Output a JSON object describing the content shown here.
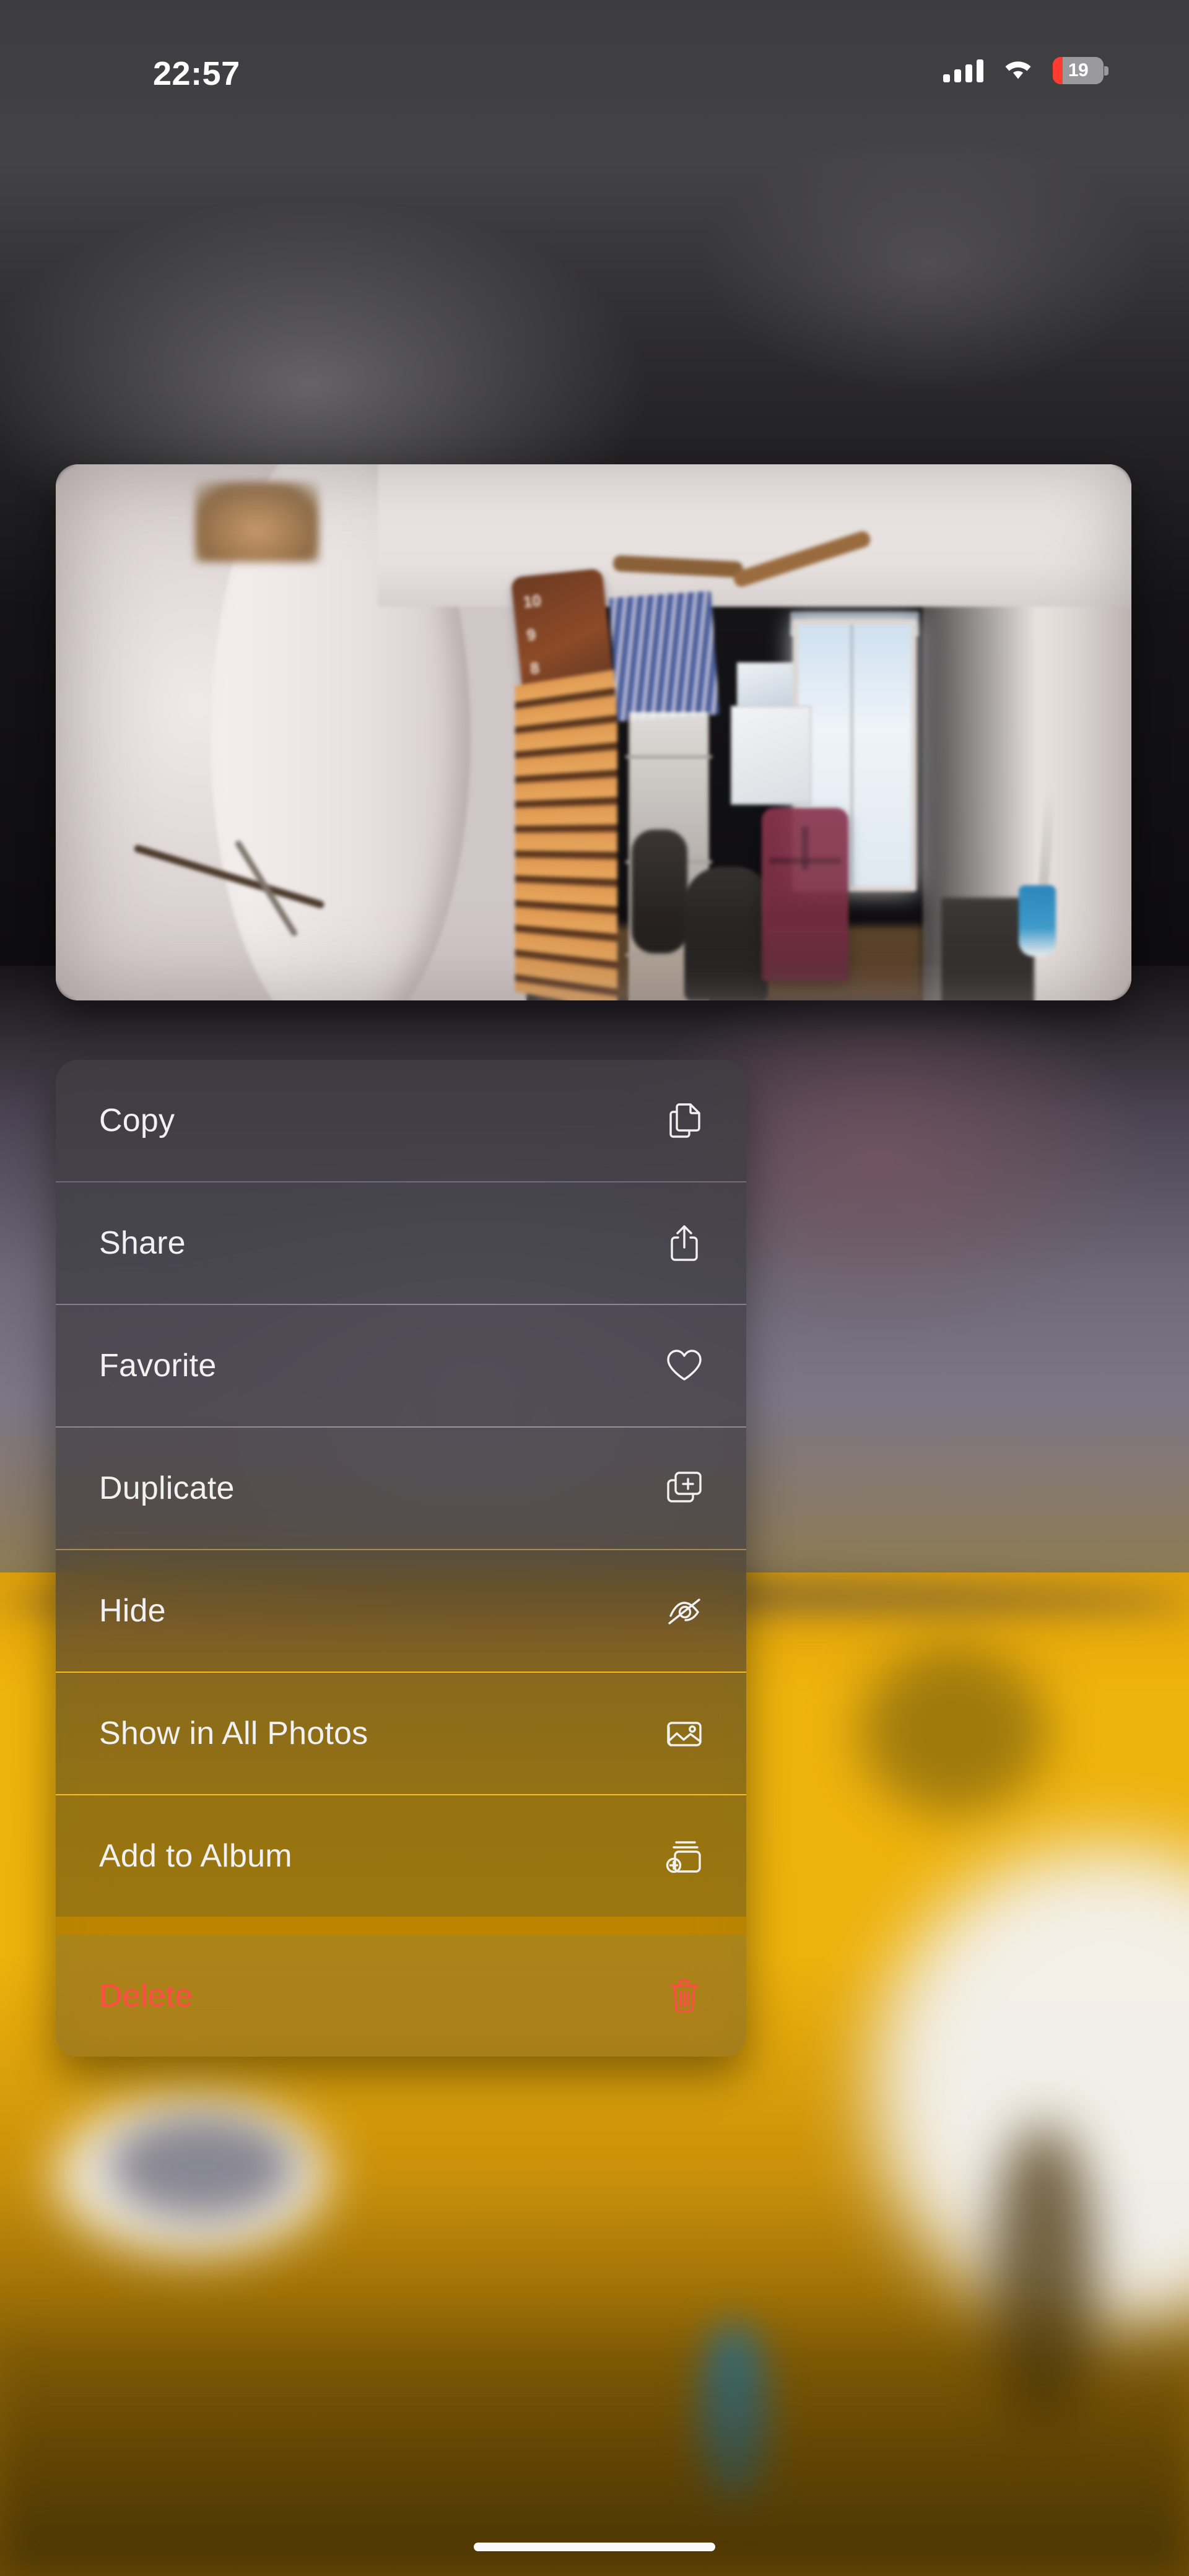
{
  "status_bar": {
    "time": "22:57",
    "cellular_icon": "cellular-signal-icon",
    "cellular_bars": 4,
    "wifi_icon": "wifi-icon",
    "battery_percent": "19",
    "battery_level": 19,
    "battery_low_color": "#ff3b30",
    "battery_shell_color": "#9a9a9d"
  },
  "photo_preview": {
    "name": "selected-photo-preview",
    "description": "360-degree panoramic photo of a room interior",
    "clock_numbers": [
      "10",
      "9",
      "8"
    ]
  },
  "context_menu": {
    "name": "photo-context-menu",
    "items": [
      {
        "label": "Copy",
        "icon": "copy-icon",
        "destructive": false
      },
      {
        "label": "Share",
        "icon": "share-icon",
        "destructive": false
      },
      {
        "label": "Favorite",
        "icon": "heart-icon",
        "destructive": false
      },
      {
        "label": "Duplicate",
        "icon": "duplicate-icon",
        "destructive": false
      },
      {
        "label": "Hide",
        "icon": "eye-slash-icon",
        "destructive": false
      },
      {
        "label": "Show in All Photos",
        "icon": "photo-stack-icon",
        "destructive": false
      },
      {
        "label": "Add to Album",
        "icon": "add-to-album-icon",
        "destructive": false
      },
      {
        "label": "Delete",
        "icon": "trash-icon",
        "destructive": true
      }
    ],
    "destructive_color": "#ff4d45",
    "label_color": "#f2f1f2"
  },
  "home_indicator": {
    "name": "home-indicator"
  }
}
